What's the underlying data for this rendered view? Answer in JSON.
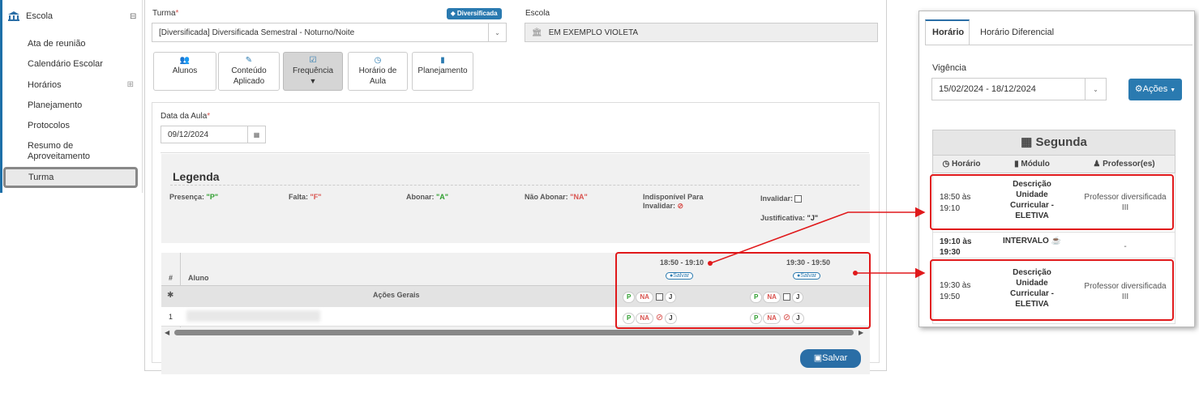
{
  "sidebar": {
    "section": "Escola",
    "items": [
      {
        "label": "Ata de reunião"
      },
      {
        "label": "Calendário Escolar"
      },
      {
        "label": "Horários"
      },
      {
        "label": "Planejamento"
      },
      {
        "label": "Protocolos"
      },
      {
        "label": "Resumo de Aproveitamento"
      },
      {
        "label": "Turma"
      }
    ]
  },
  "form": {
    "turma_label": "Turma",
    "turma_value": "[Diversificada]  Diversificada Semestral - Noturno/Noite",
    "turma_badge": "Diversificada",
    "escola_label": "Escola",
    "escola_value": "EM EXEMPLO VIOLETA"
  },
  "tabs": [
    {
      "label1": "Alunos",
      "label2": ""
    },
    {
      "label1": "Conteúdo",
      "label2": "Aplicado"
    },
    {
      "label1": "Frequência",
      "label2": ""
    },
    {
      "label1": "Horário de",
      "label2": "Aula"
    },
    {
      "label1": "Planejamento",
      "label2": ""
    }
  ],
  "data_aula": {
    "label": "Data da Aula",
    "value": "09/12/2024"
  },
  "legend": {
    "title": "Legenda",
    "presenca_label": "Presença:",
    "presenca_code": "\"P\"",
    "falta_label": "Falta:",
    "falta_code": "\"F\"",
    "abonar_label": "Abonar:",
    "abonar_code": "\"A\"",
    "nao_abonar_label": "Não Abonar:",
    "nao_abonar_code": "\"NA\"",
    "indisponivel_label1": "Indisponível Para",
    "indisponivel_label2": "Invalidar:",
    "invalidar_label": "Invalidar:",
    "justificativa_label": "Justificativa:",
    "justificativa_code": "\"J\""
  },
  "table": {
    "col_num": "#",
    "col_aluno": "Aluno",
    "acoes_gerais": "Ações Gerais",
    "slots": [
      {
        "time": "18:50 - 19:10",
        "save": "Salvar"
      },
      {
        "time": "19:30 - 19:50",
        "save": "Salvar"
      }
    ],
    "row_num": "1",
    "pill_p": "P",
    "pill_na": "NA",
    "pill_j": "J"
  },
  "save_button": "Salvar",
  "right_panel": {
    "tab_active": "Horário",
    "tab_other": "Horário Diferencial",
    "vigencia_label": "Vigência",
    "vigencia_value": "15/02/2024 - 18/12/2024",
    "acoes_button": "Ações",
    "day": "Segunda",
    "col_horario": "Horário",
    "col_modulo": "Módulo",
    "col_professor": "Professor(es)",
    "rows": [
      {
        "time1": "18:50 às",
        "time2": "19:10",
        "mod1": "Descrição",
        "mod2": "Unidade",
        "mod3": "Curricular",
        "mod4": "ELETIVA",
        "prof1": "Professor diversificada",
        "prof2": "III"
      },
      {
        "time1": "19:10 às",
        "time2": "19:30",
        "mod1": "INTERVALO",
        "prof1": "-"
      },
      {
        "time1": "19:30 às",
        "time2": "19:50",
        "mod1": "Descrição",
        "mod2": "Unidade",
        "mod3": "Curricular",
        "mod4": "ELETIVA",
        "prof1": "Professor diversificada",
        "prof2": "III"
      }
    ]
  },
  "colors": {
    "accent": "#2a6ea6",
    "highlight": "#e0191b",
    "present": "#2e9e2e",
    "absent": "#d9534f"
  }
}
